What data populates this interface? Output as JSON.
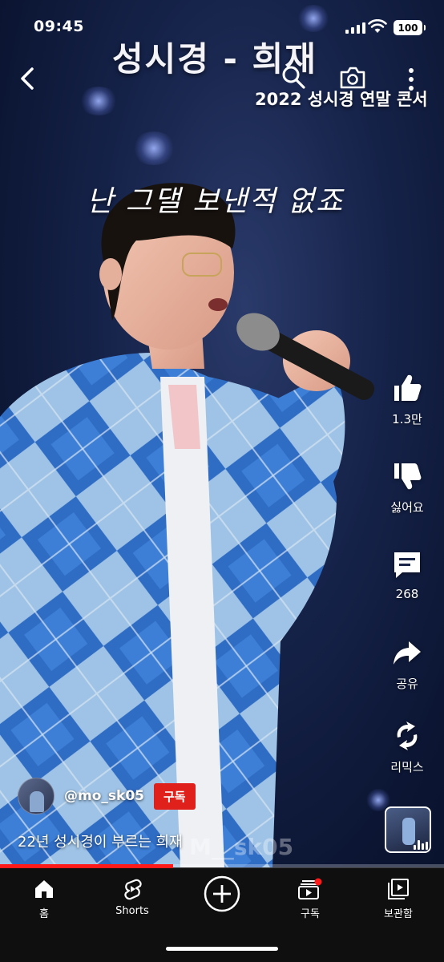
{
  "status_bar": {
    "time": "09:45",
    "battery": "100"
  },
  "overlay": {
    "title": "성시경 - 희재",
    "subtitle": "2022 성시경 연말 콘서",
    "lyric": "난 그댈 보낸적 없죠"
  },
  "actions": {
    "like": {
      "label": "1.3만",
      "icon": "thumb-up-icon"
    },
    "dislike": {
      "label": "싫어요",
      "icon": "thumb-down-icon"
    },
    "comments": {
      "label": "268",
      "icon": "comment-icon"
    },
    "share": {
      "label": "공유",
      "icon": "share-icon"
    },
    "remix": {
      "label": "리믹스",
      "icon": "remix-icon"
    }
  },
  "channel": {
    "handle": "@mo_sk05",
    "subscribe_label": "구독"
  },
  "video": {
    "description": "22년 성시경이 부르는 희재",
    "watermark": "M__sk05",
    "progress": 0.39
  },
  "bottom_nav": {
    "items": [
      {
        "label": "홈",
        "icon": "home-icon"
      },
      {
        "label": "Shorts",
        "icon": "shorts-icon"
      },
      {
        "label": "",
        "icon": "create-icon"
      },
      {
        "label": "구독",
        "icon": "subscriptions-icon"
      },
      {
        "label": "보관함",
        "icon": "library-icon"
      }
    ]
  },
  "colors": {
    "accent": "#ff1a1a",
    "subscribe": "#e0201a",
    "nav_bg": "#0f0f0f"
  }
}
